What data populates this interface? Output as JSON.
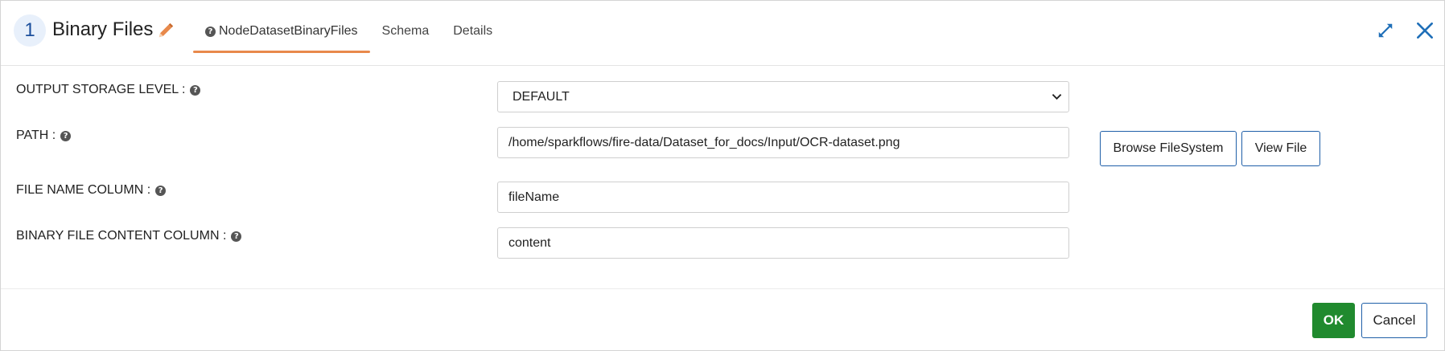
{
  "header": {
    "node_number": "1",
    "node_title": "Binary Files",
    "tabs": [
      {
        "label": "NodeDatasetBinaryFiles",
        "active": true,
        "icon": "question-circle-icon"
      },
      {
        "label": "Schema",
        "active": false
      },
      {
        "label": "Details",
        "active": false
      }
    ],
    "icons": [
      "pencil-icon",
      "expand-icon",
      "close-icon"
    ]
  },
  "form": {
    "output_storage_level": {
      "label": "OUTPUT STORAGE LEVEL :",
      "value": "DEFAULT"
    },
    "path": {
      "label": "PATH :",
      "value": "/home/sparkflows/fire-data/Dataset_for_docs/Input/OCR-dataset.png"
    },
    "file_name_column": {
      "label": "FILE NAME COLUMN :",
      "value": "fileName"
    },
    "binary_file_content_column": {
      "label": "BINARY FILE CONTENT COLUMN :",
      "value": "content"
    }
  },
  "buttons": {
    "browse": "Browse FileSystem",
    "view": "View File",
    "ok": "OK",
    "cancel": "Cancel"
  },
  "colors": {
    "accent_tab": "#e8894b",
    "primary": "#1f5fa8",
    "ok": "#208a2e"
  }
}
